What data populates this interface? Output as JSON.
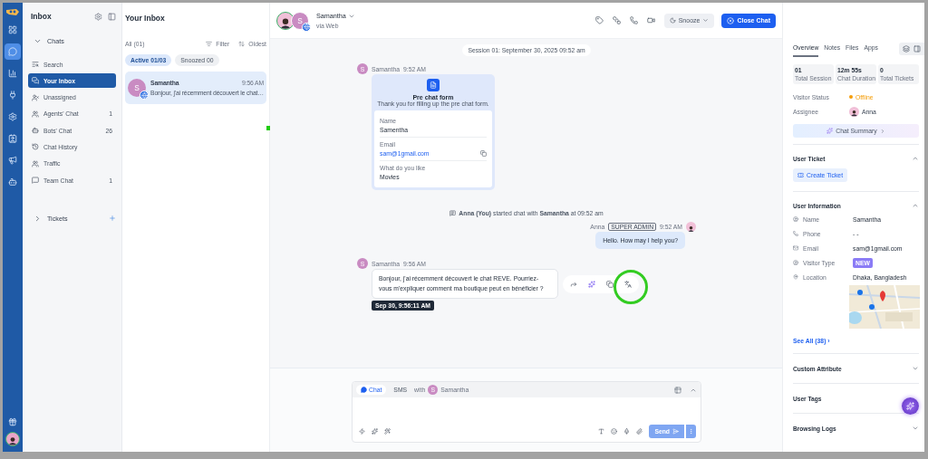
{
  "rail": {
    "items": [
      {
        "selected": false
      },
      {
        "selected": true
      },
      {
        "selected": false
      },
      {
        "selected": false
      },
      {
        "selected": false
      },
      {
        "selected": false
      },
      {
        "selected": false
      },
      {
        "selected": false
      }
    ]
  },
  "sidebar": {
    "title": "Inbox",
    "sections": [
      {
        "label": "Chats",
        "expanded": true,
        "items": [
          {
            "label": "Search",
            "selected": false
          },
          {
            "label": "Your Inbox",
            "selected": true
          },
          {
            "label": "Unassigned",
            "selected": false
          },
          {
            "label": "Agents' Chat",
            "count": "1",
            "selected": false
          },
          {
            "label": "Bots' Chat",
            "count": "26",
            "selected": false
          },
          {
            "label": "Chat History",
            "selected": false
          },
          {
            "label": "Traffic",
            "selected": false
          },
          {
            "label": "Team Chat",
            "count": "1",
            "selected": false
          }
        ]
      },
      {
        "label": "Tickets",
        "expanded": false
      }
    ]
  },
  "inbox": {
    "title": "Your Inbox",
    "all": "All (01)",
    "filter": "Filter",
    "sort": "Oldest",
    "tabs": [
      {
        "label": "Active 01/03",
        "selected": true
      },
      {
        "label": "Snoozed 00",
        "selected": false
      }
    ],
    "conversations": [
      {
        "initial": "S",
        "name": "Samantha",
        "time": "9:56 AM",
        "preview": "Bonjour, j'ai récemment découvert le chat…",
        "selected": true
      }
    ]
  },
  "chat": {
    "contact": {
      "initial": "S",
      "name": "Samantha",
      "channel": "via Web"
    },
    "snooze": "Snooze",
    "close": "Close Chat",
    "messages": [
      {
        "kind": "session",
        "text": "Session 01: September 30, 2025 09:52 am"
      },
      {
        "kind": "form",
        "initial": "S",
        "sender": "Samantha",
        "time": "9:52 AM",
        "title": "Pre chat form",
        "subtitle": "Thank you for filling up the pre chat form.",
        "fields": [
          {
            "label": "Name",
            "value": "Samentha",
            "kind": "text"
          },
          {
            "label": "Email",
            "value": "sam@1gmail.com",
            "kind": "link"
          },
          {
            "label": "What do you like",
            "value": "Movies",
            "kind": "text"
          }
        ]
      },
      {
        "kind": "event",
        "text": "**Anna (You)** started chat with **Samantha** at 09:52 am"
      },
      {
        "kind": "outgoing",
        "sender": "Anna",
        "role": "SUPER ADMIN",
        "time": "9:52 AM",
        "text": "Hello. How may I help you?"
      },
      {
        "kind": "incoming",
        "initial": "S",
        "sender": "Samantha",
        "time": "9:56 AM",
        "text": "Bonjour, j'ai récemment découvert le chat REVE. Pourriez-vous m'expliquer comment ma boutique peut en bénéficier ?",
        "tooltip": "Sep 30, 9:56:11 AM"
      }
    ],
    "composer": {
      "tabs": [
        {
          "label": "Chat",
          "selected": true
        },
        {
          "label": "SMS",
          "selected": false
        }
      ],
      "with": "with",
      "initial": "S",
      "recipient": "Samantha",
      "send": "Send"
    }
  },
  "details": {
    "tabs": [
      {
        "label": "Overview",
        "selected": true
      },
      {
        "label": "Notes",
        "selected": false
      },
      {
        "label": "Files",
        "selected": false
      },
      {
        "label": "Apps",
        "selected": false
      }
    ],
    "stats": [
      {
        "value": "01",
        "label": "Total Session"
      },
      {
        "value": "12m 55s",
        "label": "Chat Duration"
      },
      {
        "value": "0",
        "label": "Total Tickets"
      }
    ],
    "visitor_status": {
      "label": "Visitor Status",
      "value": "Offline",
      "color": "#f59e0b"
    },
    "assignee": {
      "label": "Assignee",
      "value": "Anna"
    },
    "summary": "Chat Summary",
    "user_ticket": {
      "title": "User Ticket",
      "expanded": true,
      "button": "Create Ticket"
    },
    "user_information": {
      "title": "User Information",
      "expanded": true,
      "rows": [
        {
          "label": "Name",
          "value": "Samantha",
          "kind": "text"
        },
        {
          "label": "Phone",
          "value": "- -",
          "kind": "text"
        },
        {
          "label": "Email",
          "value": "sam@1gmail.com",
          "kind": "text"
        },
        {
          "label": "Visitor Type",
          "value": "NEW",
          "kind": "badge"
        },
        {
          "label": "Location",
          "value": "Dhaka, Bangladesh",
          "kind": "map"
        }
      ],
      "see_all": "See All (38) ›"
    },
    "collapsed": [
      {
        "title": "Custom Attribute",
        "expanded": false
      },
      {
        "title": "User Tags",
        "expanded": false
      },
      {
        "title": "Browsing Logs",
        "expanded": false
      }
    ]
  }
}
